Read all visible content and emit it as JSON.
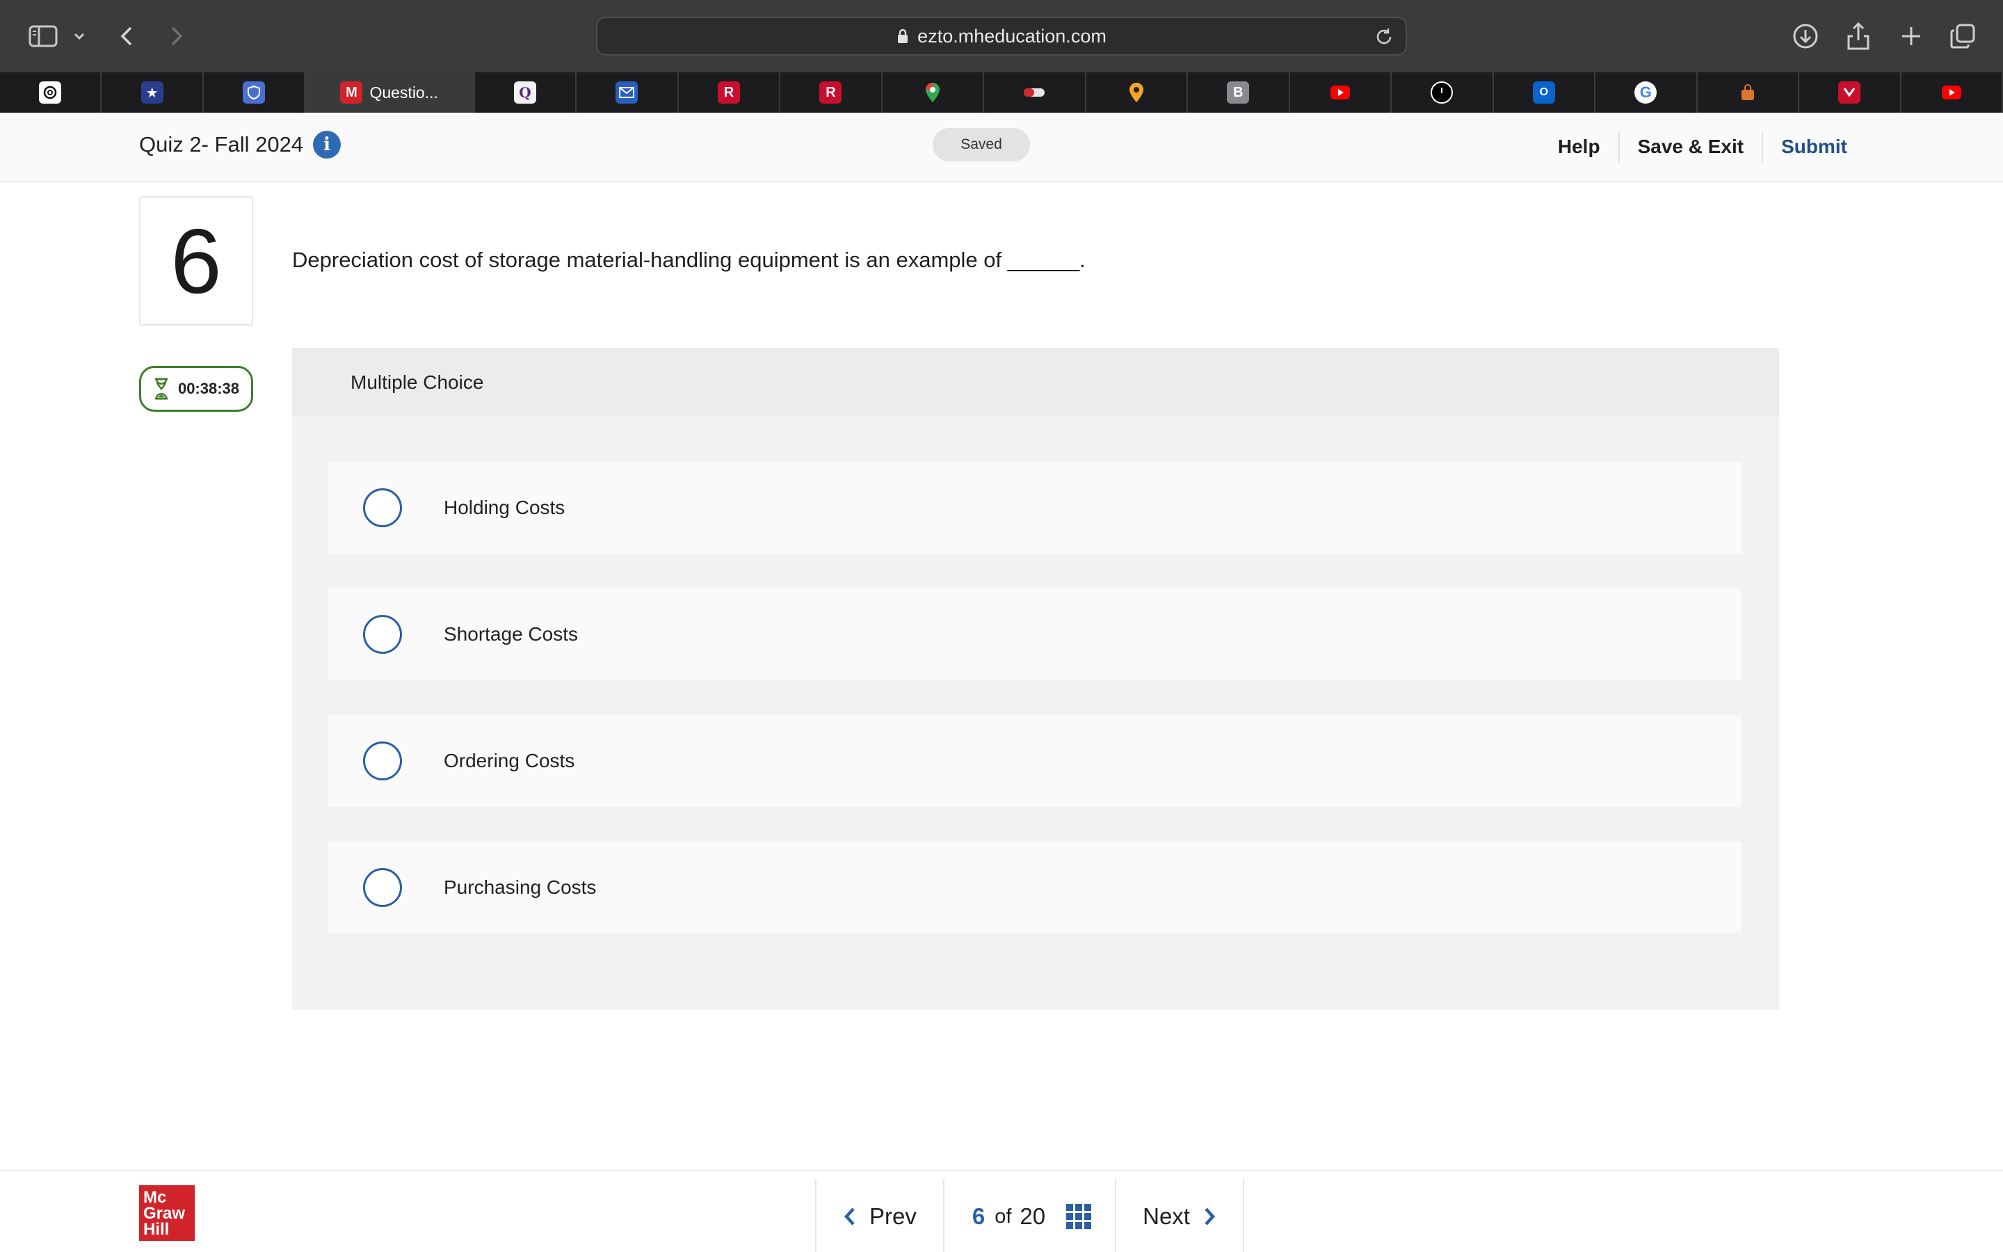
{
  "browser": {
    "url": "ezto.mheducation.com",
    "active_tab_label": "Questio..."
  },
  "header": {
    "quiz_title": "Quiz 2- Fall 2024",
    "saved_label": "Saved",
    "links": {
      "help": "Help",
      "save_exit": "Save & Exit",
      "submit": "Submit"
    }
  },
  "question": {
    "number": "6",
    "text": "Depreciation cost of storage material-handling equipment is an example of ______.",
    "timer": "00:38:38",
    "type_label": "Multiple Choice",
    "options": [
      {
        "label": "Holding Costs"
      },
      {
        "label": "Shortage Costs"
      },
      {
        "label": "Ordering Costs"
      },
      {
        "label": "Purchasing Costs"
      }
    ]
  },
  "footer": {
    "logo_lines": [
      "Mc",
      "Graw",
      "Hill"
    ],
    "prev_label": "Prev",
    "next_label": "Next",
    "current_page": "6",
    "of_label": "of",
    "total_pages": "20"
  },
  "colors": {
    "accent_blue": "#2a5fa5",
    "submit_blue": "#1f4e8c",
    "timer_green": "#3f7d2c",
    "logo_red": "#d1232a"
  }
}
